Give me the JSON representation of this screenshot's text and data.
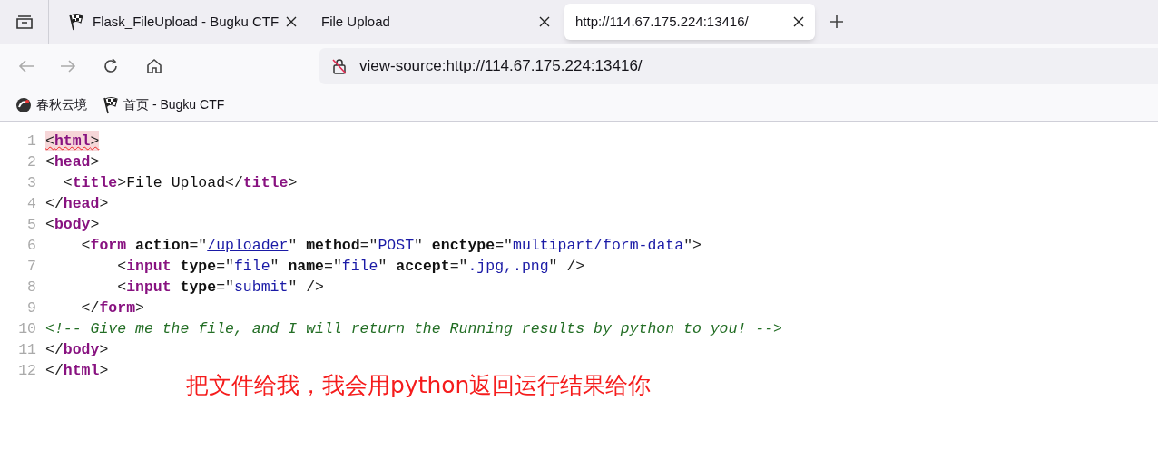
{
  "tabs": [
    {
      "label": "Flask_FileUpload - Bugku CTF",
      "kind": "flag",
      "selected": false
    },
    {
      "label": "File Upload",
      "kind": "plain",
      "selected": false
    },
    {
      "label": "http://114.67.175.224:13416/",
      "kind": "plain",
      "selected": true
    }
  ],
  "address_bar": {
    "value": "view-source:http://114.67.175.224:13416/"
  },
  "bookmarks": [
    {
      "label": "春秋云境",
      "kind": "swirl"
    },
    {
      "label": "首页 - Bugku CTF",
      "kind": "flag"
    }
  ],
  "source_lines": [
    {
      "number": "1",
      "error": true,
      "tokens": [
        {
          "kind": "punct",
          "text": "<"
        },
        {
          "kind": "tag",
          "text": "html"
        },
        {
          "kind": "punct",
          "text": ">"
        }
      ]
    },
    {
      "number": "2",
      "error": false,
      "tokens": [
        {
          "kind": "punct",
          "text": "<"
        },
        {
          "kind": "tag",
          "text": "head"
        },
        {
          "kind": "punct",
          "text": ">"
        }
      ]
    },
    {
      "number": "3",
      "error": false,
      "tokens": [
        {
          "kind": "punct",
          "text": "  <"
        },
        {
          "kind": "tag",
          "text": "title"
        },
        {
          "kind": "punct",
          "text": ">"
        },
        {
          "kind": "text",
          "text": "File Upload"
        },
        {
          "kind": "punct",
          "text": "</"
        },
        {
          "kind": "tag",
          "text": "title"
        },
        {
          "kind": "punct",
          "text": ">"
        }
      ]
    },
    {
      "number": "4",
      "error": false,
      "tokens": [
        {
          "kind": "punct",
          "text": "</"
        },
        {
          "kind": "tag",
          "text": "head"
        },
        {
          "kind": "punct",
          "text": ">"
        }
      ]
    },
    {
      "number": "5",
      "error": false,
      "tokens": [
        {
          "kind": "punct",
          "text": "<"
        },
        {
          "kind": "tag",
          "text": "body"
        },
        {
          "kind": "punct",
          "text": ">"
        }
      ]
    },
    {
      "number": "6",
      "error": false,
      "tokens": [
        {
          "kind": "punct",
          "text": "    <"
        },
        {
          "kind": "tag",
          "text": "form "
        },
        {
          "kind": "attr",
          "text": "action"
        },
        {
          "kind": "punct",
          "text": "=\""
        },
        {
          "kind": "link",
          "text": "/uploader"
        },
        {
          "kind": "punct",
          "text": "\" "
        },
        {
          "kind": "attr",
          "text": "method"
        },
        {
          "kind": "punct",
          "text": "=\""
        },
        {
          "kind": "value",
          "text": "POST"
        },
        {
          "kind": "punct",
          "text": "\" "
        },
        {
          "kind": "attr",
          "text": "enctype"
        },
        {
          "kind": "punct",
          "text": "=\""
        },
        {
          "kind": "value",
          "text": "multipart/form-data"
        },
        {
          "kind": "punct",
          "text": "\">"
        }
      ]
    },
    {
      "number": "7",
      "error": false,
      "tokens": [
        {
          "kind": "punct",
          "text": "        <"
        },
        {
          "kind": "tag",
          "text": "input "
        },
        {
          "kind": "attr",
          "text": "type"
        },
        {
          "kind": "punct",
          "text": "=\""
        },
        {
          "kind": "value",
          "text": "file"
        },
        {
          "kind": "punct",
          "text": "\" "
        },
        {
          "kind": "attr",
          "text": "name"
        },
        {
          "kind": "punct",
          "text": "=\""
        },
        {
          "kind": "value",
          "text": "file"
        },
        {
          "kind": "punct",
          "text": "\" "
        },
        {
          "kind": "attr",
          "text": "accept"
        },
        {
          "kind": "punct",
          "text": "=\""
        },
        {
          "kind": "value",
          "text": ".jpg,.png"
        },
        {
          "kind": "punct",
          "text": "\" />"
        }
      ]
    },
    {
      "number": "8",
      "error": false,
      "tokens": [
        {
          "kind": "punct",
          "text": "        <"
        },
        {
          "kind": "tag",
          "text": "input "
        },
        {
          "kind": "attr",
          "text": "type"
        },
        {
          "kind": "punct",
          "text": "=\""
        },
        {
          "kind": "value",
          "text": "submit"
        },
        {
          "kind": "punct",
          "text": "\" />"
        }
      ]
    },
    {
      "number": "9",
      "error": false,
      "tokens": [
        {
          "kind": "punct",
          "text": "    </"
        },
        {
          "kind": "tag",
          "text": "form"
        },
        {
          "kind": "punct",
          "text": ">"
        }
      ]
    },
    {
      "number": "10",
      "error": false,
      "tokens": [
        {
          "kind": "comment",
          "text": "<!-- Give me the file, and I will return the Running results by python to you! -->"
        }
      ]
    },
    {
      "number": "11",
      "error": false,
      "tokens": [
        {
          "kind": "punct",
          "text": "</"
        },
        {
          "kind": "tag",
          "text": "body"
        },
        {
          "kind": "punct",
          "text": ">"
        }
      ]
    },
    {
      "number": "12",
      "error": false,
      "tokens": [
        {
          "kind": "punct",
          "text": "</"
        },
        {
          "kind": "tag",
          "text": "html"
        },
        {
          "kind": "punct",
          "text": ">"
        }
      ]
    }
  ],
  "annotation": "把文件给我，我会用python返回运行结果给你"
}
